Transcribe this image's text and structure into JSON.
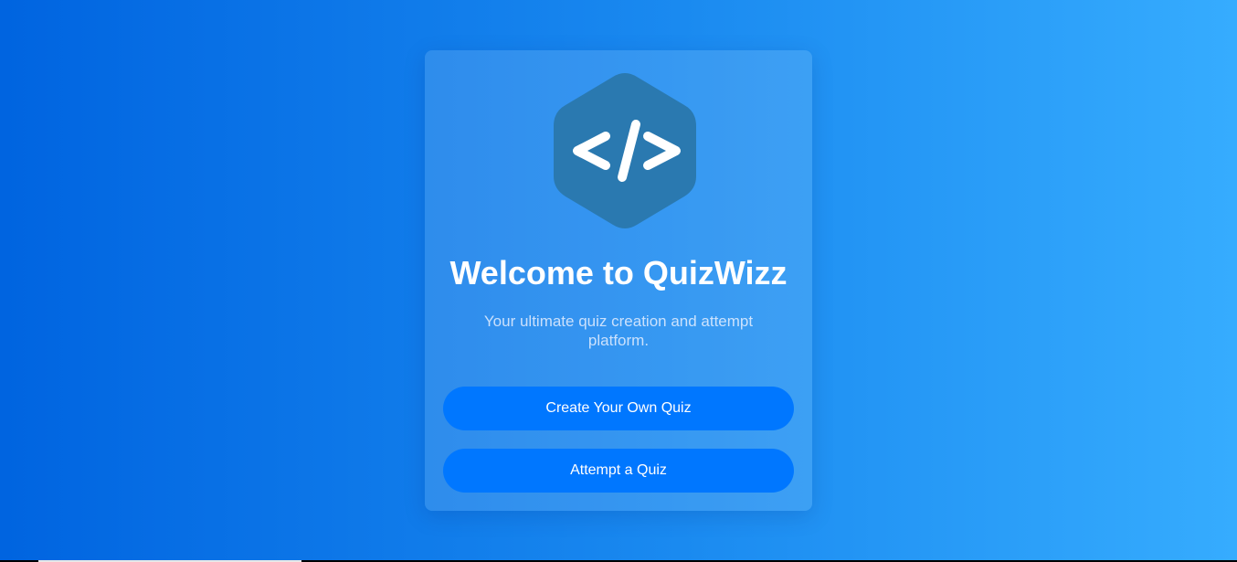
{
  "welcome": {
    "logo_icon": "code-brackets-icon",
    "logo_color": "#2a79b0",
    "title": "Welcome to QuizWizz",
    "subtitle": "Your ultimate quiz creation and attempt platform."
  },
  "actions": {
    "create_label": "Create Your Own Quiz",
    "attempt_label": "Attempt a Quiz"
  },
  "colors": {
    "accent": "#0077ff",
    "background_start": "#0064e0",
    "background_end": "#36acfe"
  }
}
